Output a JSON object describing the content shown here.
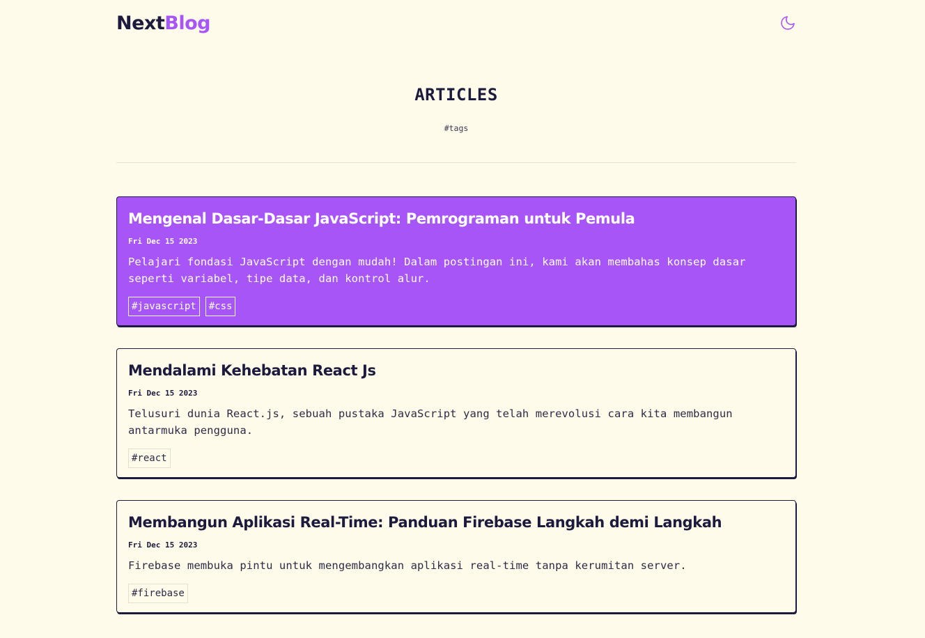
{
  "brand": {
    "name_part1": "Next",
    "name_part2": "Blog",
    "accent": "#a855f7",
    "ink": "#1c1a3d"
  },
  "header": {
    "theme_toggle_icon": "moon-icon"
  },
  "hero": {
    "title": "ARTICLES",
    "tags_link": "#tags"
  },
  "articles": [
    {
      "title": "Mengenal Dasar-Dasar JavaScript: Pemrograman untuk Pemula",
      "date": "Fri Dec 15 2023",
      "description": "Pelajari fondasi JavaScript dengan mudah! Dalam postingan ini, kami akan membahas konsep dasar seperti variabel, tipe data, dan kontrol alur.",
      "tags": [
        "#javascript",
        "#css"
      ],
      "highlighted": true
    },
    {
      "title": "Mendalami Kehebatan React Js",
      "date": "Fri Dec 15 2023",
      "description": "Telusuri dunia React.js, sebuah pustaka JavaScript yang telah merevolusi cara kita membangun antarmuka pengguna.",
      "tags": [
        "#react"
      ],
      "highlighted": false
    },
    {
      "title": "Membangun Aplikasi Real-Time: Panduan Firebase Langkah demi Langkah",
      "date": "Fri Dec 15 2023",
      "description": "Firebase membuka pintu untuk mengembangkan aplikasi real-time tanpa kerumitan server.",
      "tags": [
        "#firebase"
      ],
      "highlighted": false
    }
  ]
}
